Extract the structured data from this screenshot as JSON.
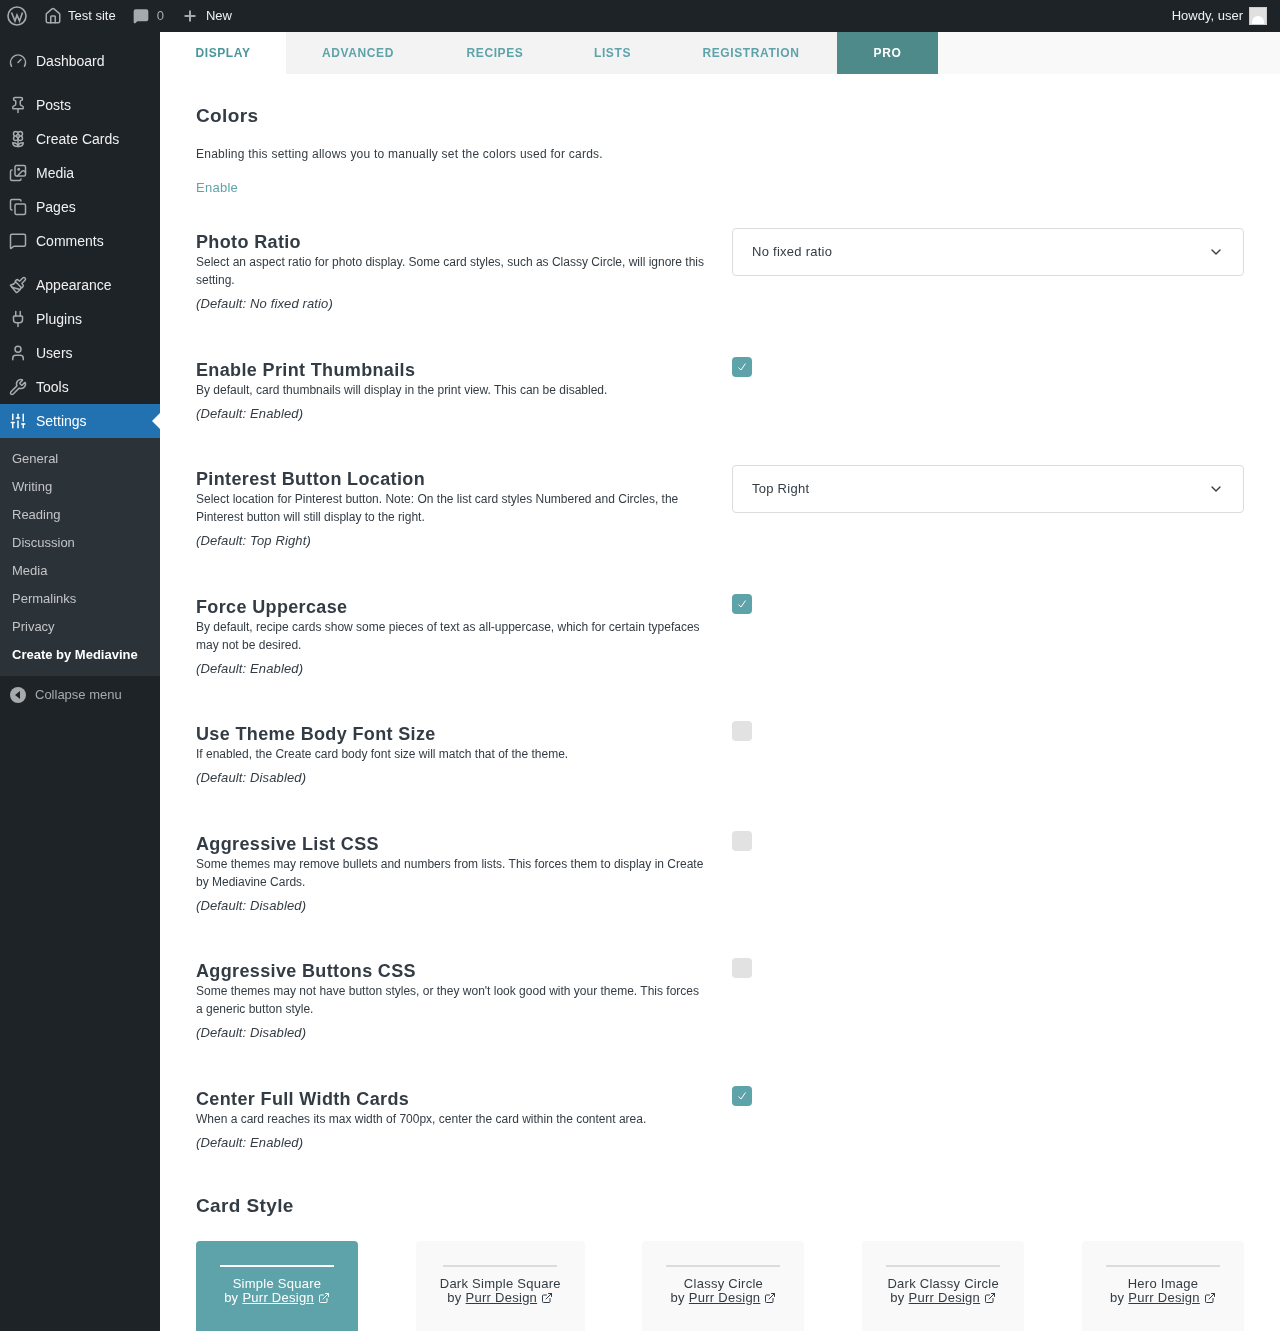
{
  "admin_bar": {
    "site": "Test site",
    "comments": "0",
    "new": "New",
    "greeting": "Howdy, user"
  },
  "sidebar": {
    "items": [
      {
        "label": "Dashboard",
        "selected": false
      },
      {
        "label": "Posts",
        "selected": false
      },
      {
        "label": "Create Cards",
        "selected": false
      },
      {
        "label": "Media",
        "selected": false
      },
      {
        "label": "Pages",
        "selected": false
      },
      {
        "label": "Comments",
        "selected": false
      },
      {
        "label": "Appearance",
        "selected": false
      },
      {
        "label": "Plugins",
        "selected": false
      },
      {
        "label": "Users",
        "selected": false
      },
      {
        "label": "Tools",
        "selected": false
      },
      {
        "label": "Settings",
        "selected": true
      }
    ],
    "submenu": [
      {
        "label": "General",
        "selected": false
      },
      {
        "label": "Writing",
        "selected": false
      },
      {
        "label": "Reading",
        "selected": false
      },
      {
        "label": "Discussion",
        "selected": false
      },
      {
        "label": "Media",
        "selected": false
      },
      {
        "label": "Permalinks",
        "selected": false
      },
      {
        "label": "Privacy",
        "selected": false
      },
      {
        "label": "Create by Mediavine",
        "selected": true
      }
    ],
    "collapse": "Collapse menu"
  },
  "tabs": [
    {
      "label": "DISPLAY",
      "selected": true,
      "kind": "normal"
    },
    {
      "label": "ADVANCED",
      "selected": false,
      "kind": "normal"
    },
    {
      "label": "RECIPES",
      "selected": false,
      "kind": "normal"
    },
    {
      "label": "LISTS",
      "selected": false,
      "kind": "normal"
    },
    {
      "label": "REGISTRATION",
      "selected": false,
      "kind": "normal"
    },
    {
      "label": "PRO",
      "selected": false,
      "kind": "pro"
    }
  ],
  "colors": {
    "title": "Colors",
    "description": "Enabling this setting allows you to manually set the colors used for cards.",
    "link": "Enable"
  },
  "settings": [
    {
      "kind": "select",
      "title": "Photo Ratio",
      "description": "Select an aspect ratio for photo display. Some card styles, such as Classy Circle, will ignore this setting.",
      "default": "(Default: No fixed ratio)",
      "value": "No fixed ratio"
    },
    {
      "kind": "checkbox",
      "title": "Enable Print Thumbnails",
      "description": "By default, card thumbnails will display in the print view. This can be disabled.",
      "default": "(Default: Enabled)",
      "checked": true
    },
    {
      "kind": "select",
      "title": "Pinterest Button Location",
      "description": "Select location for Pinterest button. Note: On the list card styles Numbered and Circles, the Pinterest button will still display to the right.",
      "default": "(Default: Top Right)",
      "value": "Top Right"
    },
    {
      "kind": "checkbox",
      "title": "Force Uppercase",
      "description": "By default, recipe cards show some pieces of text as all-uppercase, which for certain typefaces may not be desired.",
      "default": "(Default: Enabled)",
      "checked": true
    },
    {
      "kind": "checkbox",
      "title": "Use Theme Body Font Size",
      "description": "If enabled, the Create card body font size will match that of the theme.",
      "default": "(Default: Disabled)",
      "checked": false
    },
    {
      "kind": "checkbox",
      "title": "Aggressive List CSS",
      "description": "Some themes may remove bullets and numbers from lists. This forces them to display in Create by Mediavine Cards.",
      "default": "(Default: Disabled)",
      "checked": false
    },
    {
      "kind": "checkbox",
      "title": "Aggressive Buttons CSS",
      "description": "Some themes may not have button styles, or they won't look good with your theme. This forces a generic button style.",
      "default": "(Default: Disabled)",
      "checked": false
    },
    {
      "kind": "checkbox",
      "title": "Center Full Width Cards",
      "description": "When a card reaches its max width of 700px, center the card within the content area.",
      "default": "(Default: Enabled)",
      "checked": true
    }
  ],
  "card_style": {
    "title": "Card Style",
    "styles": [
      {
        "name": "Simple Square",
        "by": "by",
        "author": "Purr Design",
        "selected": true
      },
      {
        "name": "Dark Simple Square",
        "by": "by",
        "author": "Purr Design",
        "selected": false
      },
      {
        "name": "Classy Circle",
        "by": "by",
        "author": "Purr Design",
        "selected": false
      },
      {
        "name": "Dark Classy Circle",
        "by": "by",
        "author": "Purr Design",
        "selected": false
      },
      {
        "name": "Hero Image",
        "by": "by",
        "author": "Purr Design",
        "selected": false
      }
    ]
  }
}
